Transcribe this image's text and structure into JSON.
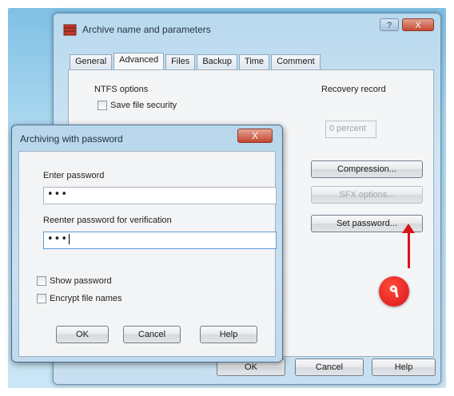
{
  "main_window": {
    "title": "Archive name and parameters",
    "help_button": "?",
    "close_button": "X",
    "tabs": [
      {
        "label": "General"
      },
      {
        "label": "Advanced"
      },
      {
        "label": "Files"
      },
      {
        "label": "Backup"
      },
      {
        "label": "Time"
      },
      {
        "label": "Comment"
      }
    ],
    "active_tab": "Advanced",
    "ntfs_options_label": "NTFS options",
    "save_file_security_label": "Save file security",
    "recovery_record_label": "Recovery record",
    "recovery_field_value": "0 percent",
    "buttons": {
      "compression": "Compression...",
      "sfx_options": "SFX options...",
      "set_password": "Set password..."
    },
    "footer_buttons": {
      "ok": "OK",
      "cancel": "Cancel",
      "help": "Help"
    }
  },
  "dialog": {
    "title": "Archiving with password",
    "close_button": "X",
    "enter_password_label": "Enter password",
    "enter_password_value": "•••",
    "reenter_password_label": "Reenter password for verification",
    "reenter_password_value": "•••",
    "show_password_label": "Show password",
    "encrypt_file_names_label": "Encrypt file names",
    "buttons": {
      "ok": "OK",
      "cancel": "Cancel",
      "help": "Help"
    }
  },
  "annotation": {
    "step_badge": "۹",
    "color": "#d8161b"
  },
  "icons": [
    "app-archive-icon",
    "help-icon",
    "close-icon",
    "arrow-up-icon"
  ]
}
